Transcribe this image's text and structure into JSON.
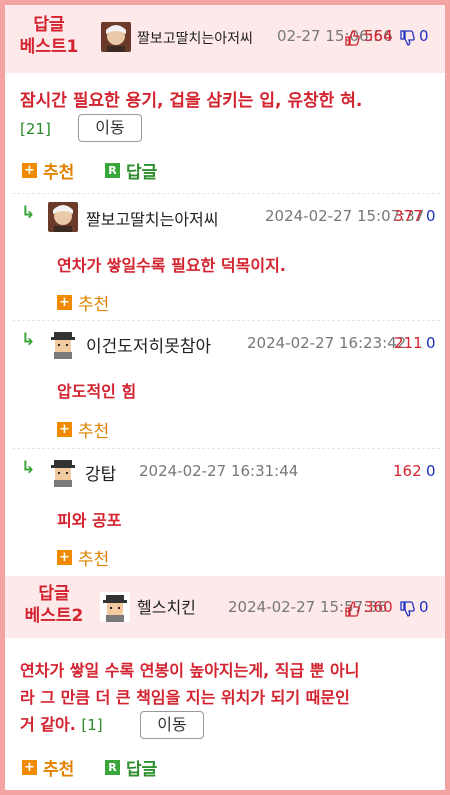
{
  "best1": {
    "tag": "답글\n베스트1",
    "tag_line1": "답글",
    "tag_line2": "베스트1",
    "nickname": "짤보고딸치는아저씨",
    "date": "02-27 15:06:56",
    "up": "564",
    "down": "0",
    "body": "잠시간 필요한 용기, 겁을 삼키는 입, 유창한 혀.",
    "count": "[21]",
    "move_label": "이동",
    "recommend_label": "추천",
    "reply_label": "답글"
  },
  "replies": [
    {
      "nickname": "짤보고딸치는아저씨",
      "date": "2024-02-27 15:07:37",
      "up": "377",
      "down": "0",
      "body": "연차가 쌓일수록 필요한 덕목이지.",
      "recommend_label": "추천"
    },
    {
      "nickname": "이건도저히못참아",
      "date": "2024-02-27 16:23:42",
      "up": "211",
      "down": "0",
      "body": "압도적인 힘",
      "recommend_label": "추천"
    },
    {
      "nickname": "강탑",
      "date": "2024-02-27 16:31:44",
      "up": "162",
      "down": "0",
      "body": "피와 공포",
      "recommend_label": "추천"
    }
  ],
  "best2": {
    "tag_line1": "답글",
    "tag_line2": "베스트2",
    "nickname": "헬스치킨",
    "date": "2024-02-27 15:57:36",
    "up": "360",
    "down": "0",
    "body_line1": "연차가 쌓일 수록 연봉이 높아지는게, 직급 뿐 아니",
    "body_line2": "라 그 만큼 더 큰 책임을 지는 위치가 되기 때문인",
    "body_line3": "거 같아.",
    "count": "[1]",
    "move_label": "이동",
    "recommend_label": "추천",
    "reply_label": "답글"
  },
  "icons": {
    "reply_arrow": "reply-arrow-icon",
    "thumb_up": "thumb-up-icon",
    "thumb_down": "thumb-down-icon",
    "plus": "plus-box-icon",
    "r": "reply-r-icon"
  },
  "colors": {
    "frame": "#f4a3a3",
    "best_bg": "#fde9ea",
    "red": "#d3232f",
    "blue": "#1f2fbf",
    "orange": "#f08a00",
    "green": "#3aa53a"
  }
}
